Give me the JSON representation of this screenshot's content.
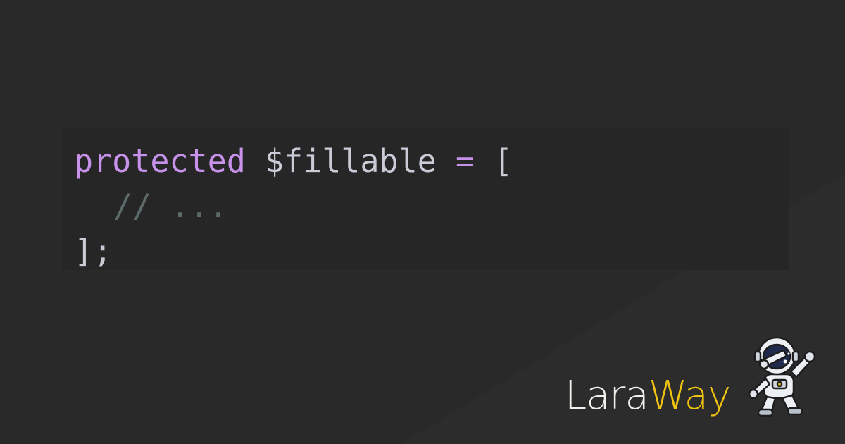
{
  "code": {
    "line1": {
      "keyword": "protected",
      "variable": "$fillable",
      "operator": "=",
      "bracket": "["
    },
    "line2": {
      "comment": "// ..."
    },
    "line3": {
      "closing": "];"
    }
  },
  "brand": {
    "part1": "Lara",
    "part2": "Way",
    "accent_color": "#f1c40f"
  },
  "colors": {
    "background": "#292929",
    "code_background": "#262626",
    "keyword": "#c792ea",
    "comment": "#5c6a6a"
  },
  "icons": {
    "mascot": "astronaut-dab-icon"
  }
}
